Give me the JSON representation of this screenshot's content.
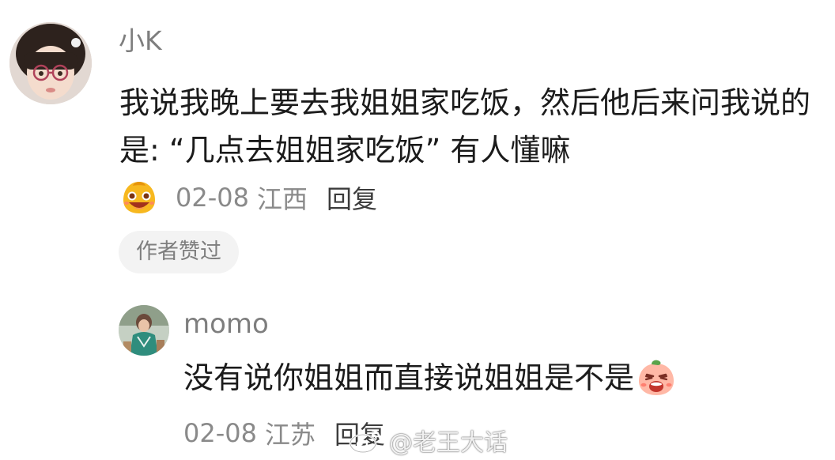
{
  "comment": {
    "username": "小K",
    "body": "我说我晚上要去我姐姐家吃饭，然后他后来问我说的是: “几点去姐姐家吃饭” 有人懂嘛",
    "date": "02-08",
    "location": "江西",
    "reply_label": "回复",
    "author_liked": "作者赞过",
    "emoji": "laughing-face-emoji"
  },
  "reply": {
    "username": "momo",
    "body": "没有说你姐姐而直接说姐姐是不是",
    "emoji": "shocked-peach-emoji",
    "date": "02-08",
    "location": "江苏",
    "reply_label": "回复"
  },
  "watermark": {
    "text": "@老王大话"
  },
  "colors": {
    "text_primary": "#1b1b1b",
    "text_secondary": "#7e7e7e",
    "chip_background": "#f3f3f3"
  }
}
